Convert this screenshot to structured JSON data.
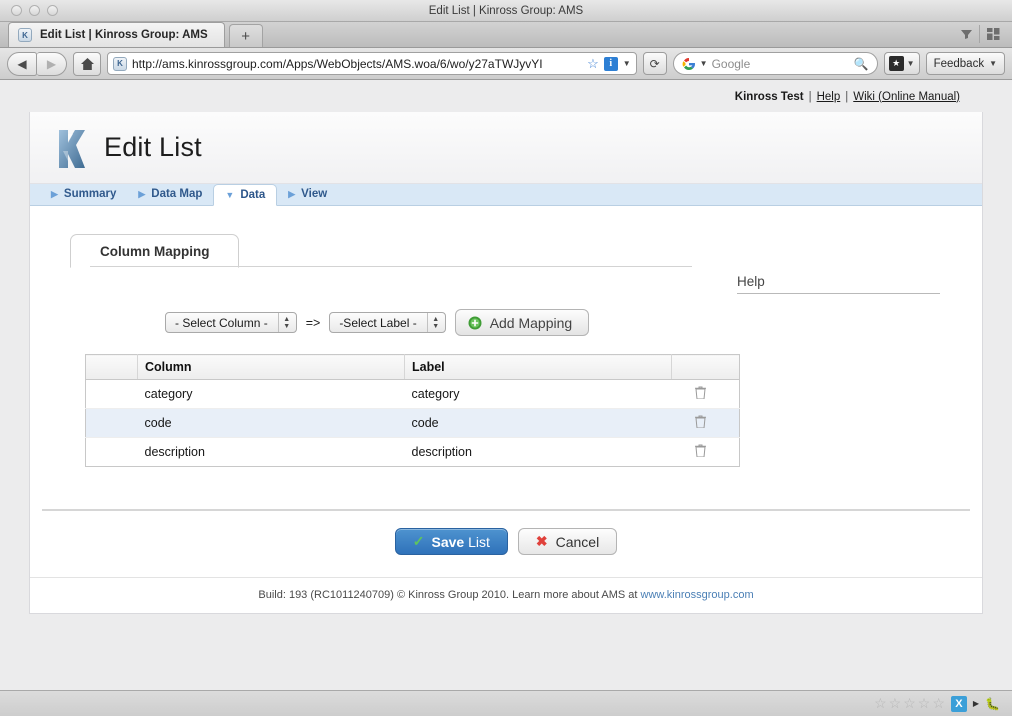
{
  "window": {
    "title": "Edit List | Kinross Group: AMS"
  },
  "browser": {
    "tab": {
      "label": "Edit List | Kinross Group: AMS",
      "favicon": "kinross-favicon"
    },
    "new_tab_label": "+",
    "nav": {
      "back": "◀",
      "forward": "▶",
      "home": "home-icon",
      "reload": "⟳"
    },
    "url": "http://ams.kinrossgroup.com/Apps/WebObjects/AMS.woa/6/wo/y27aTWJyvYI",
    "url_badge": "i",
    "search": {
      "engine": "Google",
      "placeholder": "Google"
    },
    "bookmarks_button": "★",
    "feedback_button": "Feedback"
  },
  "topbar": {
    "account": "Kinross Test",
    "help_link": "Help",
    "wiki_link": "Wiki (Online Manual)",
    "separator": "|"
  },
  "page": {
    "title": "Edit List",
    "tabs": [
      {
        "label": "Summary",
        "marker": "▶",
        "active": false
      },
      {
        "label": "Data Map",
        "marker": "▶",
        "active": false
      },
      {
        "label": "Data",
        "marker": "▼",
        "active": true
      },
      {
        "label": "View",
        "marker": "▶",
        "active": false
      }
    ],
    "inner_tab": "Column Mapping",
    "help_heading": "Help",
    "mapping_form": {
      "column_select": "- Select Column -",
      "arrow": "=>",
      "label_select": "-Select Label -",
      "add_button": "Add Mapping"
    },
    "table": {
      "headers": [
        "",
        "Column",
        "Label",
        ""
      ],
      "rows": [
        {
          "column": "category",
          "label": "category",
          "delete": "trash-icon"
        },
        {
          "column": "code",
          "label": "code",
          "delete": "trash-icon"
        },
        {
          "column": "description",
          "label": "description",
          "delete": "trash-icon"
        }
      ]
    },
    "buttons": {
      "save_strong": "Save",
      "save_rest": " List",
      "cancel": "Cancel"
    },
    "footer": {
      "text": "Build: 193 (RC1011240709) © Kinross Group 2010. Learn more about AMS at ",
      "link": "www.kinrossgroup.com"
    }
  },
  "statusbar": {
    "stars": [
      "☆",
      "☆",
      "☆",
      "☆",
      "☆"
    ],
    "badge": "X"
  },
  "colors": {
    "accent_blue": "#2f72ba",
    "tabbar_blue": "#d9e8f6",
    "row_highlight": "#e8eff8",
    "link_blue": "#4a7fb5",
    "check_green": "#5ec45e",
    "x_red": "#e0413b"
  }
}
